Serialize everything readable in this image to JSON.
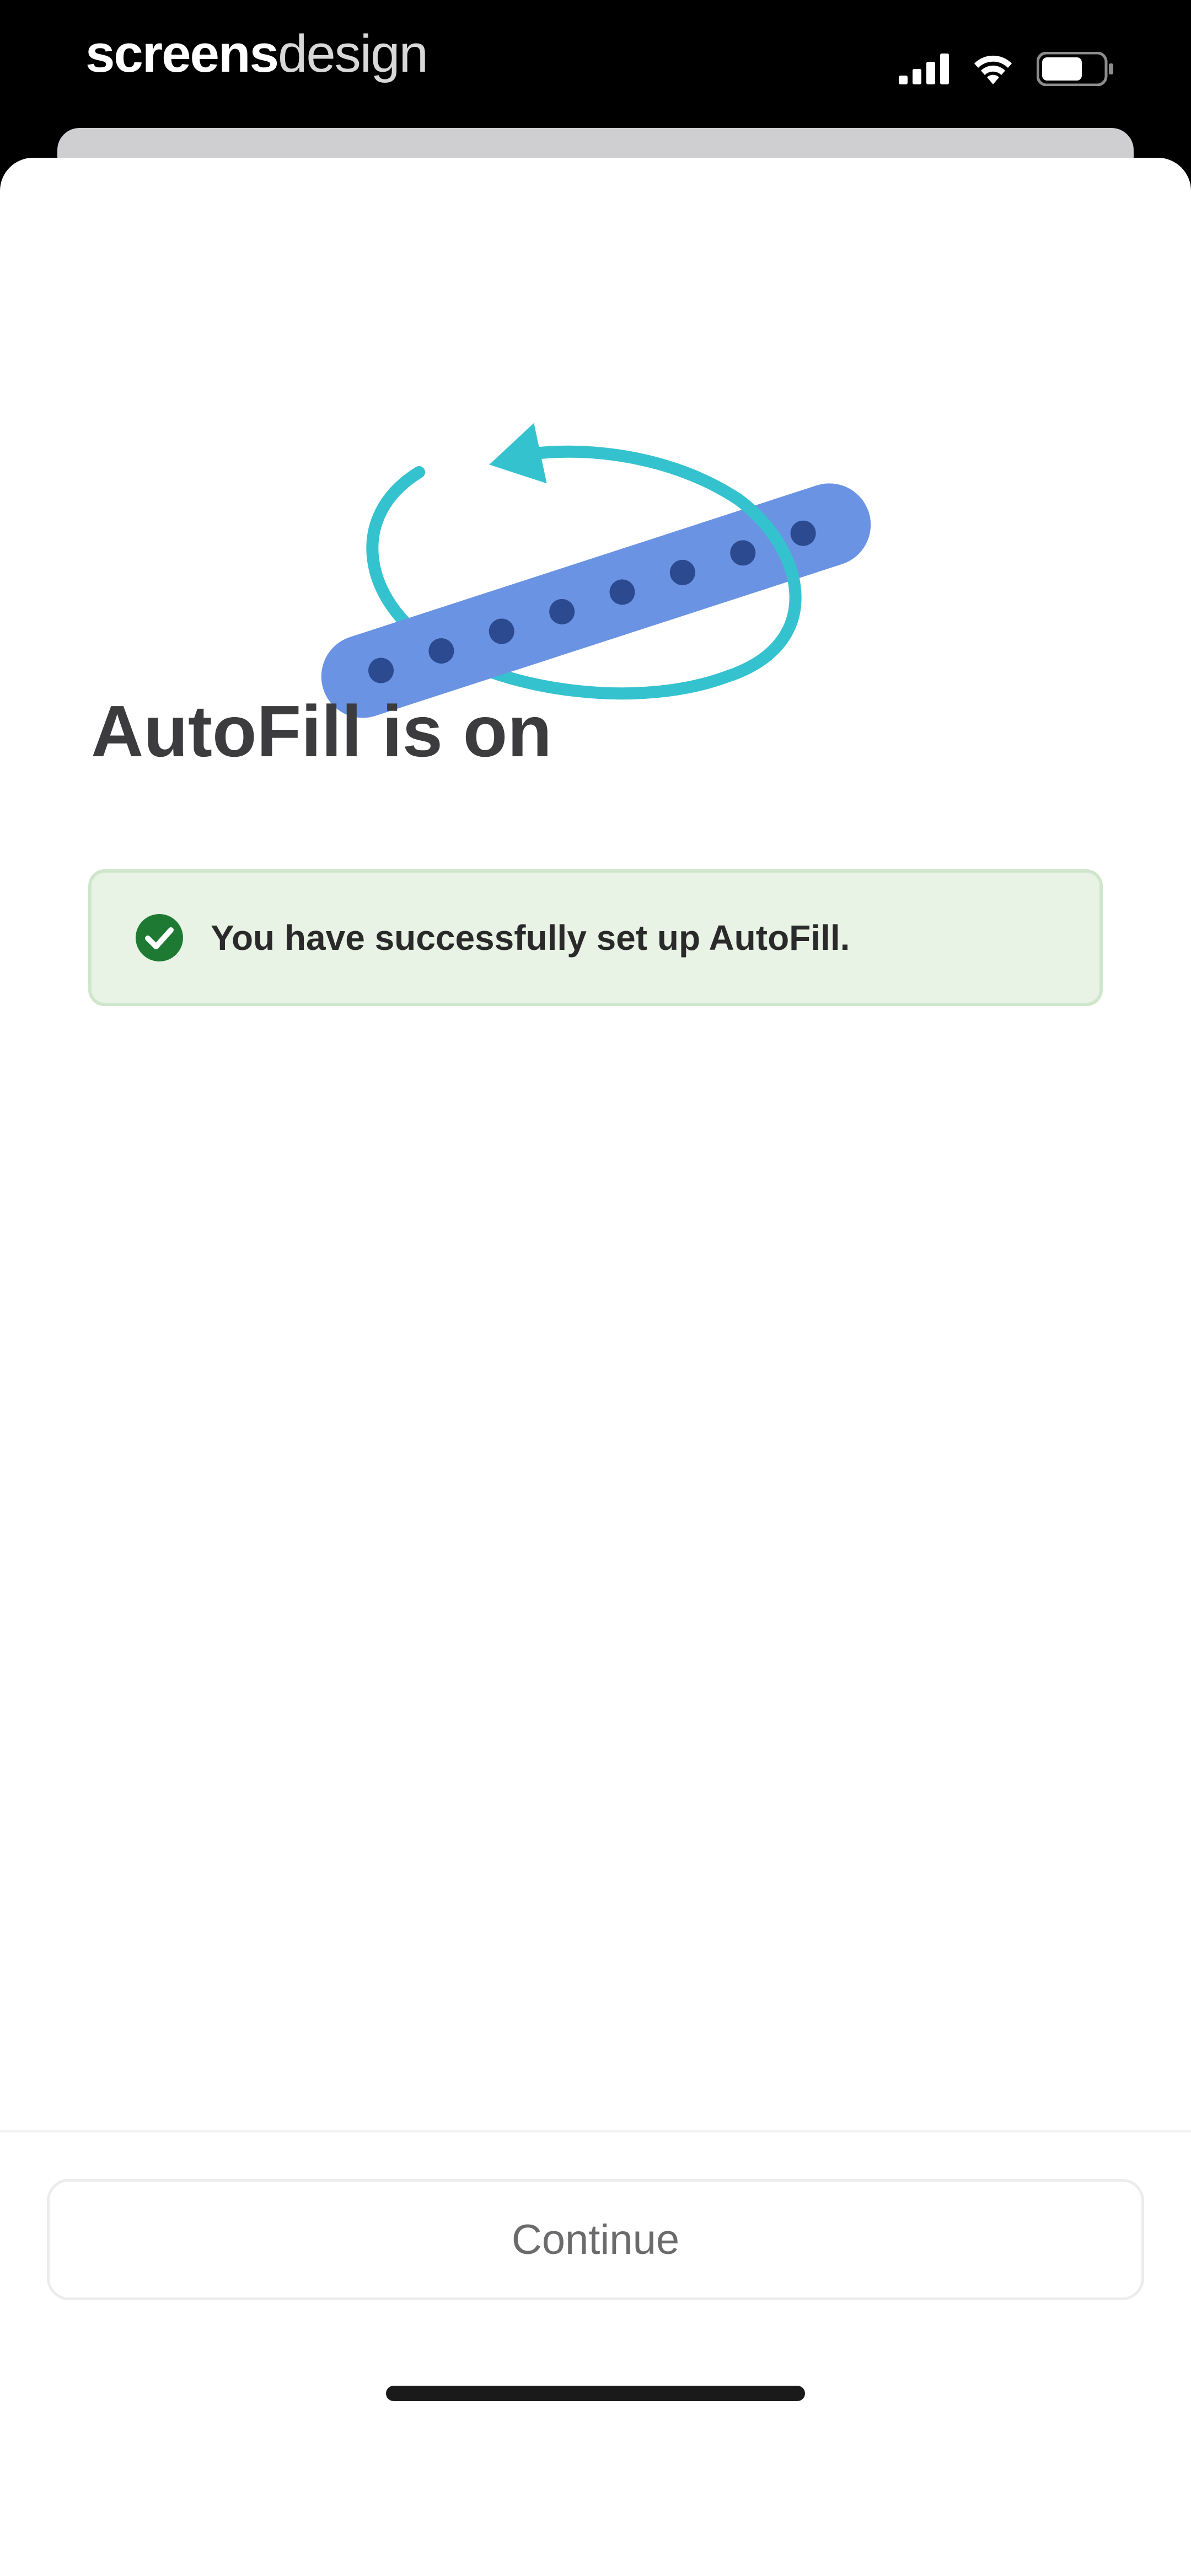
{
  "status_bar": {
    "brand_part1": "screens",
    "brand_part2": "design",
    "icons": [
      "cellular-signal-icon",
      "wifi-icon",
      "battery-icon"
    ]
  },
  "main": {
    "illustration": "autofill-password-illustration",
    "title": "AutoFill is on",
    "success_message": "You have successfully set up AutoFill.",
    "success_icon": "check-circle-icon"
  },
  "footer": {
    "continue_label": "Continue"
  },
  "colors": {
    "accent_blue": "#6b93e3",
    "accent_teal": "#35c2cf",
    "success_green": "#1e7a32",
    "success_bg": "#e8f3e6"
  }
}
